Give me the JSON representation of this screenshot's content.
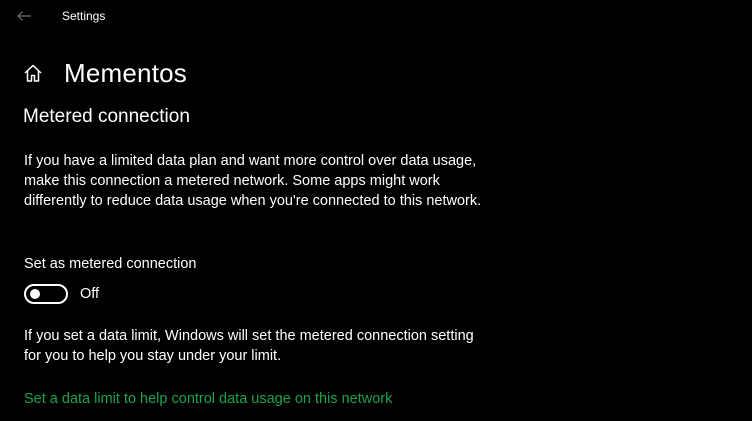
{
  "window": {
    "title": "Settings",
    "back_icon": "back-arrow-icon"
  },
  "header": {
    "home_icon": "home-icon",
    "title": "Mementos"
  },
  "section": {
    "title": "Metered connection",
    "description": "If you have a limited data plan and want more control over data usage, make this connection a metered network. Some apps might work differently to reduce data usage when you're connected to this network."
  },
  "metered_toggle": {
    "label": "Set as metered connection",
    "state_text": "Off",
    "is_on": false
  },
  "info": {
    "text": "If you set a data limit, Windows will set the metered connection setting for you to help you stay under your limit."
  },
  "data_limit_link": {
    "text": "Set a data limit to help control data usage on this network"
  },
  "colors": {
    "background": "#000000",
    "text": "#ffffff",
    "link": "#1aa34a"
  }
}
